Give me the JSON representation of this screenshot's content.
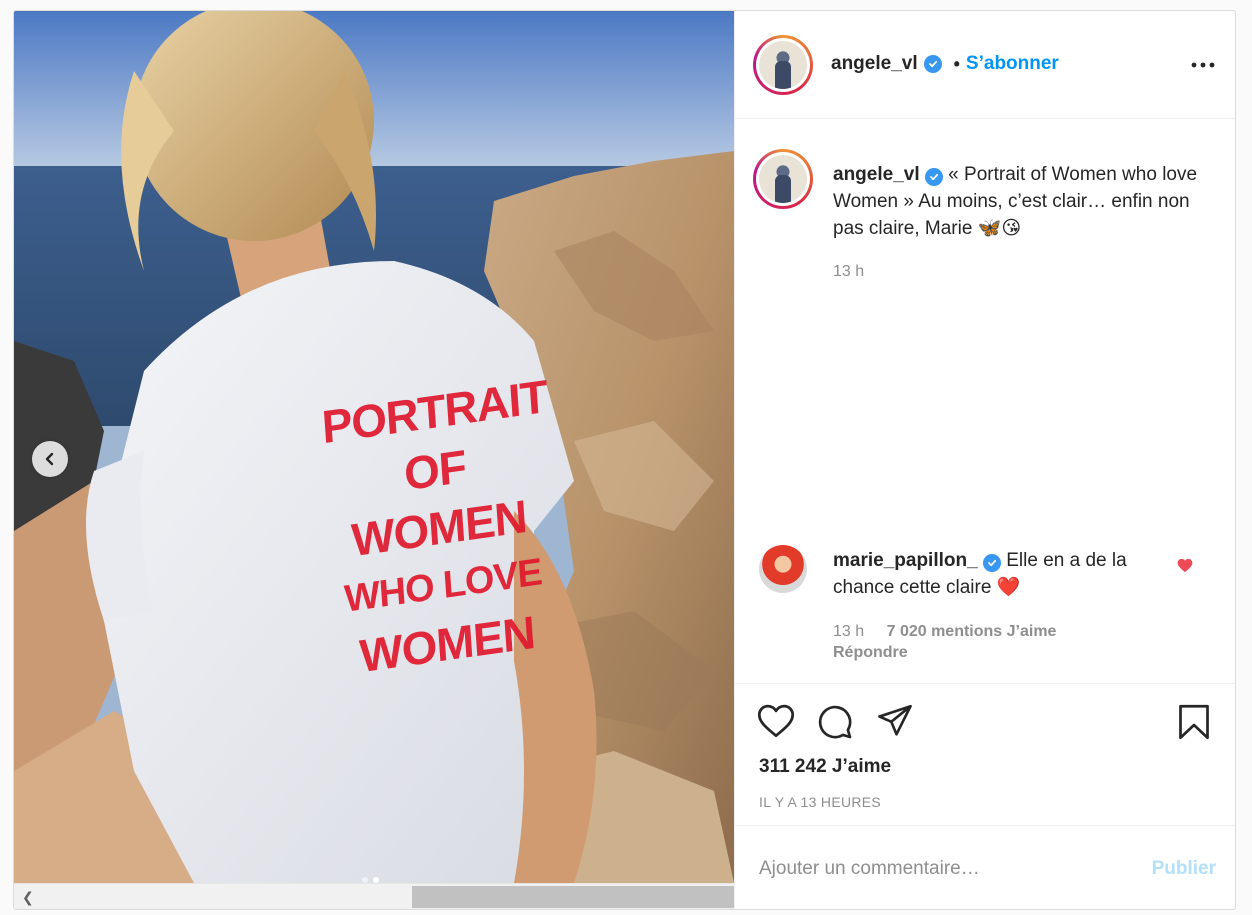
{
  "header": {
    "username": "angele_vl",
    "separator": "•",
    "follow_label": "S’abonner"
  },
  "caption": {
    "username": "angele_vl",
    "text": "« Portrait of Women who love Women » Au moins, c’est clair… enfin non pas claire, Marie 🦋😘",
    "time": "13 h"
  },
  "comment": {
    "username": "marie_papillon_",
    "text": "Elle en a de la chance cette claire ❤️",
    "time": "13 h",
    "likes": "7 020 mentions J’aime",
    "reply": "Répondre"
  },
  "actions": {
    "likes_count": "311 242 J’aime",
    "posted": "IL Y A 13 HEURES"
  },
  "add_comment": {
    "placeholder": "Ajouter un commentaire…",
    "publish_label": "Publier"
  },
  "photo": {
    "shirt_lines": [
      "PORTRAIT",
      "OF",
      "WOMEN",
      "WHO LOVE",
      "WOMEN"
    ],
    "carousel": {
      "slides": 2,
      "current": 2
    }
  },
  "colors": {
    "link_blue": "#0095f6",
    "verified_blue": "#3897f0",
    "heart_red": "#ed4956",
    "publish_disabled": "#b2dffc",
    "shirt_print_red": "#e0182d"
  },
  "icons": [
    "chevron-left-icon",
    "more-options-icon",
    "verified-badge-icon",
    "heart-icon",
    "comment-icon",
    "share-icon",
    "bookmark-icon"
  ]
}
